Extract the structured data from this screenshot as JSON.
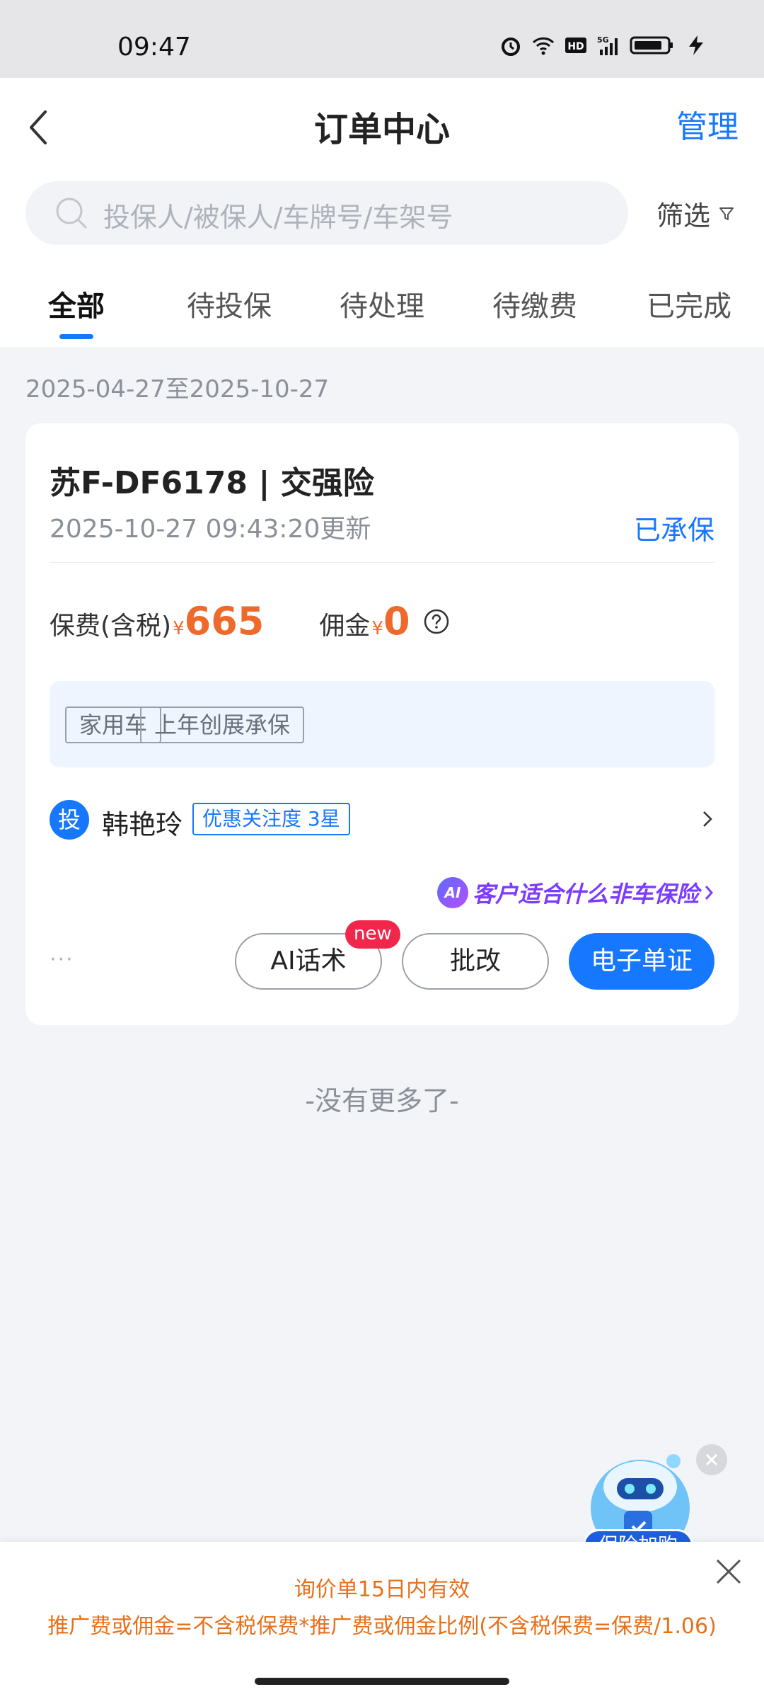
{
  "status_bar": {
    "time": "09:47"
  },
  "header": {
    "title": "订单中心",
    "manage_label": "管理"
  },
  "search": {
    "placeholder": "投保人/被保人/车牌号/车架号"
  },
  "filter": {
    "label": "筛选"
  },
  "tabs": [
    {
      "label": "全部",
      "active": true
    },
    {
      "label": "待投保"
    },
    {
      "label": "待处理"
    },
    {
      "label": "待缴费"
    },
    {
      "label": "已完成"
    }
  ],
  "date_range": "2025-04-27至2025-10-27",
  "order": {
    "title": "苏F-DF6178 | 交强险",
    "updated": "2025-10-27 09:43:20更新",
    "status": "已承保",
    "premium_label": "保费(含税)",
    "premium_currency": "¥",
    "premium_value": "665",
    "commission_label": "佣金",
    "commission_currency": "¥",
    "commission_value": "0",
    "tags": [
      "家用车",
      "上年创展承保"
    ],
    "insured_avatar": "投",
    "insured_name": "韩艳玲",
    "insured_badge": "优惠关注度 3星",
    "ai_promo_logo": "AI",
    "ai_promo_text": "客户适合什么非车保险",
    "more_dots": "···",
    "buttons": {
      "ai_script": "AI话术",
      "new_badge": "new",
      "endorse": "批改",
      "e_document": "电子单证"
    }
  },
  "no_more_text": "-没有更多了-",
  "robot": {
    "label": "保险加购"
  },
  "bottom_banner": {
    "line1": "询价单15日内有效",
    "line2": "推广费或佣金=不含税保费*推广费或佣金比例(不含税保费=保费/1.06)"
  },
  "colors": {
    "accent": "#1677ff",
    "amount": "#ee6a2c",
    "banner_text": "#e8701a",
    "new_badge": "#f0264a"
  }
}
